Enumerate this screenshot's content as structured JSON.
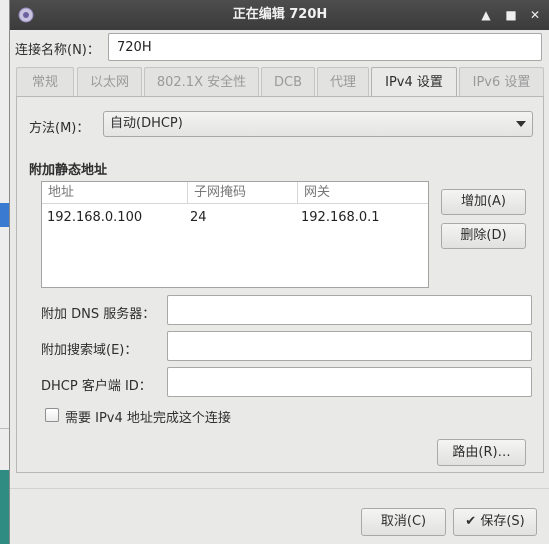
{
  "window": {
    "title": "正在编辑 720H"
  },
  "connection": {
    "label": "连接名称(N)：",
    "value": "720H"
  },
  "tabs": [
    {
      "label": "常规",
      "active": false
    },
    {
      "label": "以太网",
      "active": false
    },
    {
      "label": "802.1X 安全性",
      "active": false
    },
    {
      "label": "DCB",
      "active": false
    },
    {
      "label": "代理",
      "active": false
    },
    {
      "label": "IPv4 设置",
      "active": true
    },
    {
      "label": "IPv6 设置",
      "active": false
    }
  ],
  "method": {
    "label": "方法(M)：",
    "value": "自动(DHCP)"
  },
  "static": {
    "heading": "附加静态地址",
    "columns": [
      "地址",
      "子网掩码",
      "网关"
    ],
    "rows": [
      [
        "192.168.0.100",
        "24",
        "192.168.0.1"
      ]
    ],
    "add_label": "增加(A)",
    "delete_label": "删除(D)"
  },
  "fields": {
    "dns_label": "附加 DNS 服务器：",
    "dns_value": "",
    "search_label": "附加搜索域(E)：",
    "search_value": "",
    "dhcp_label": "DHCP 客户端 ID：",
    "dhcp_value": ""
  },
  "require": {
    "label": "需要 IPv4 地址完成这个连接",
    "checked": false
  },
  "routes_label": "路由(R)…",
  "footer": {
    "cancel_label": "取消(C)",
    "save_label": "保存(S)",
    "save_icon": "✔"
  },
  "titlebar_icons": {
    "up": "▲",
    "maximize": "■",
    "close": "✕"
  },
  "colors": {
    "titlebar": "#404040",
    "window_bg": "#e9e9e8",
    "disabled_tab_text": "#9a9a9a"
  }
}
